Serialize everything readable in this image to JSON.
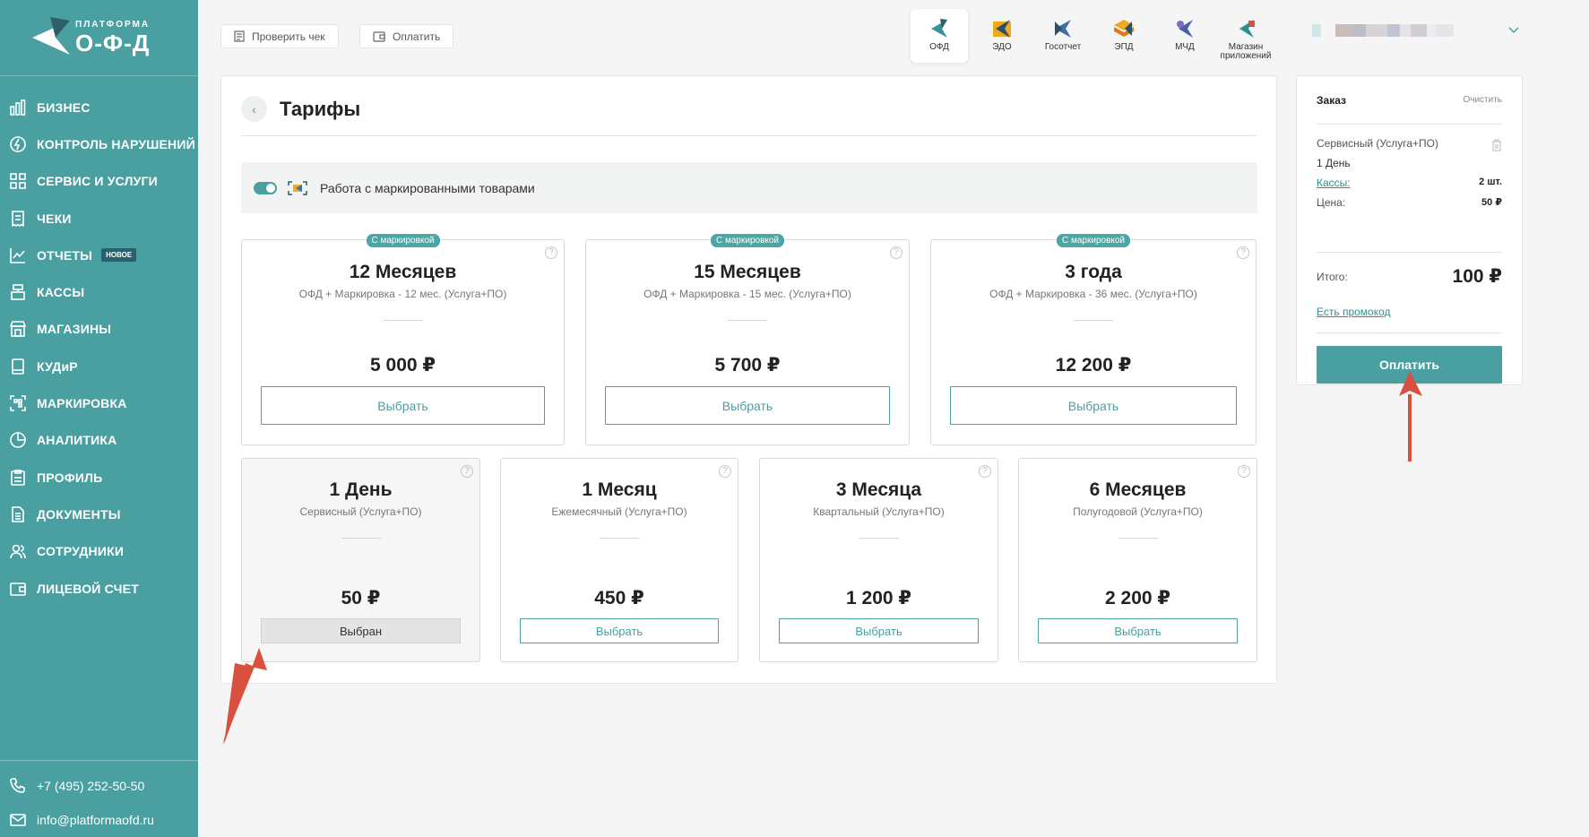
{
  "brand": {
    "top": "ПЛАТФОРМА",
    "bottom": "О-Ф-Д"
  },
  "sidebar": {
    "items": [
      {
        "label": "БИЗНЕС",
        "icon": "bar-chart-icon"
      },
      {
        "label": "КОНТРОЛЬ НАРУШЕНИЙ",
        "icon": "lightning-icon"
      },
      {
        "label": "СЕРВИС И УСЛУГИ",
        "icon": "grid-icon"
      },
      {
        "label": "ЧЕКИ",
        "icon": "receipt-icon"
      },
      {
        "label": "ОТЧЕТЫ",
        "icon": "report-chart-icon",
        "badge": "НОВОЕ"
      },
      {
        "label": "КАССЫ",
        "icon": "cash-register-icon"
      },
      {
        "label": "МАГАЗИНЫ",
        "icon": "store-icon"
      },
      {
        "label": "КУДиР",
        "icon": "book-icon"
      },
      {
        "label": "МАРКИРОВКА",
        "icon": "qr-scan-icon"
      },
      {
        "label": "АНАЛИТИКА",
        "icon": "pie-icon"
      },
      {
        "label": "ПРОФИЛЬ",
        "icon": "profile-clipboard-icon"
      },
      {
        "label": "ДОКУМЕНТЫ",
        "icon": "document-icon"
      },
      {
        "label": "СОТРУДНИКИ",
        "icon": "users-icon"
      },
      {
        "label": "ЛИЦЕВОЙ СЧЕТ",
        "icon": "wallet-icon"
      }
    ],
    "footer": {
      "phone": "+7 (495) 252-50-50",
      "email": "info@platformaofd.ru"
    }
  },
  "topbar": {
    "check_receipt": "Проверить чек",
    "pay": "Оплатить",
    "products": [
      {
        "label": "ОФД",
        "active": true
      },
      {
        "label": "ЭДО",
        "active": false
      },
      {
        "label": "Госотчет",
        "active": false
      },
      {
        "label": "ЭПД",
        "active": false
      },
      {
        "label": "МЧД",
        "active": false
      },
      {
        "label": "Магазин приложений",
        "active": false
      }
    ]
  },
  "page": {
    "title": "Тарифы",
    "toggle_label": "Работа с маркированными товарами",
    "toggle_on": true
  },
  "tariffs_top": [
    {
      "tag": "С маркировкой",
      "title": "12 Месяцев",
      "sub": "ОФД + Маркировка - 12 мес. (Услуга+ПО)",
      "price": "5 000 ₽",
      "button": "Выбрать"
    },
    {
      "tag": "С маркировкой",
      "title": "15 Месяцев",
      "sub": "ОФД + Маркировка - 15 мес. (Услуга+ПО)",
      "price": "5 700 ₽",
      "button": "Выбрать"
    },
    {
      "tag": "С маркировкой",
      "title": "3 года",
      "sub": "ОФД + Маркировка - 36 мес. (Услуга+ПО)",
      "price": "12 200 ₽",
      "button": "Выбрать"
    }
  ],
  "tariffs_bottom": [
    {
      "title": "1 День",
      "sub": "Сервисный (Услуга+ПО)",
      "price": "50 ₽",
      "button": "Выбран",
      "selected": true
    },
    {
      "title": "1 Месяц",
      "sub": "Ежемесячный (Услуга+ПО)",
      "price": "450 ₽",
      "button": "Выбрать",
      "selected": false
    },
    {
      "title": "3 Месяца",
      "sub": "Квартальный (Услуга+ПО)",
      "price": "1 200 ₽",
      "button": "Выбрать",
      "selected": false
    },
    {
      "title": "6 Месяцев",
      "sub": "Полугодовой (Услуга+ПО)",
      "price": "2 200 ₽",
      "button": "Выбрать",
      "selected": false
    }
  ],
  "order": {
    "title": "Заказ",
    "clear": "Очистить",
    "item_name": "Сервисный (Услуга+ПО)",
    "item_period": "1 День",
    "kassy_label": "Кассы:",
    "kassy_value": "2 шт.",
    "price_label": "Цена:",
    "price_value": "50 ₽",
    "total_label": "Итого:",
    "total_value": "100 ₽",
    "promo": "Есть промокод",
    "pay": "Оплатить"
  },
  "colors": {
    "accent": "#4a9fa0",
    "annotation_arrow": "#d9503f"
  }
}
